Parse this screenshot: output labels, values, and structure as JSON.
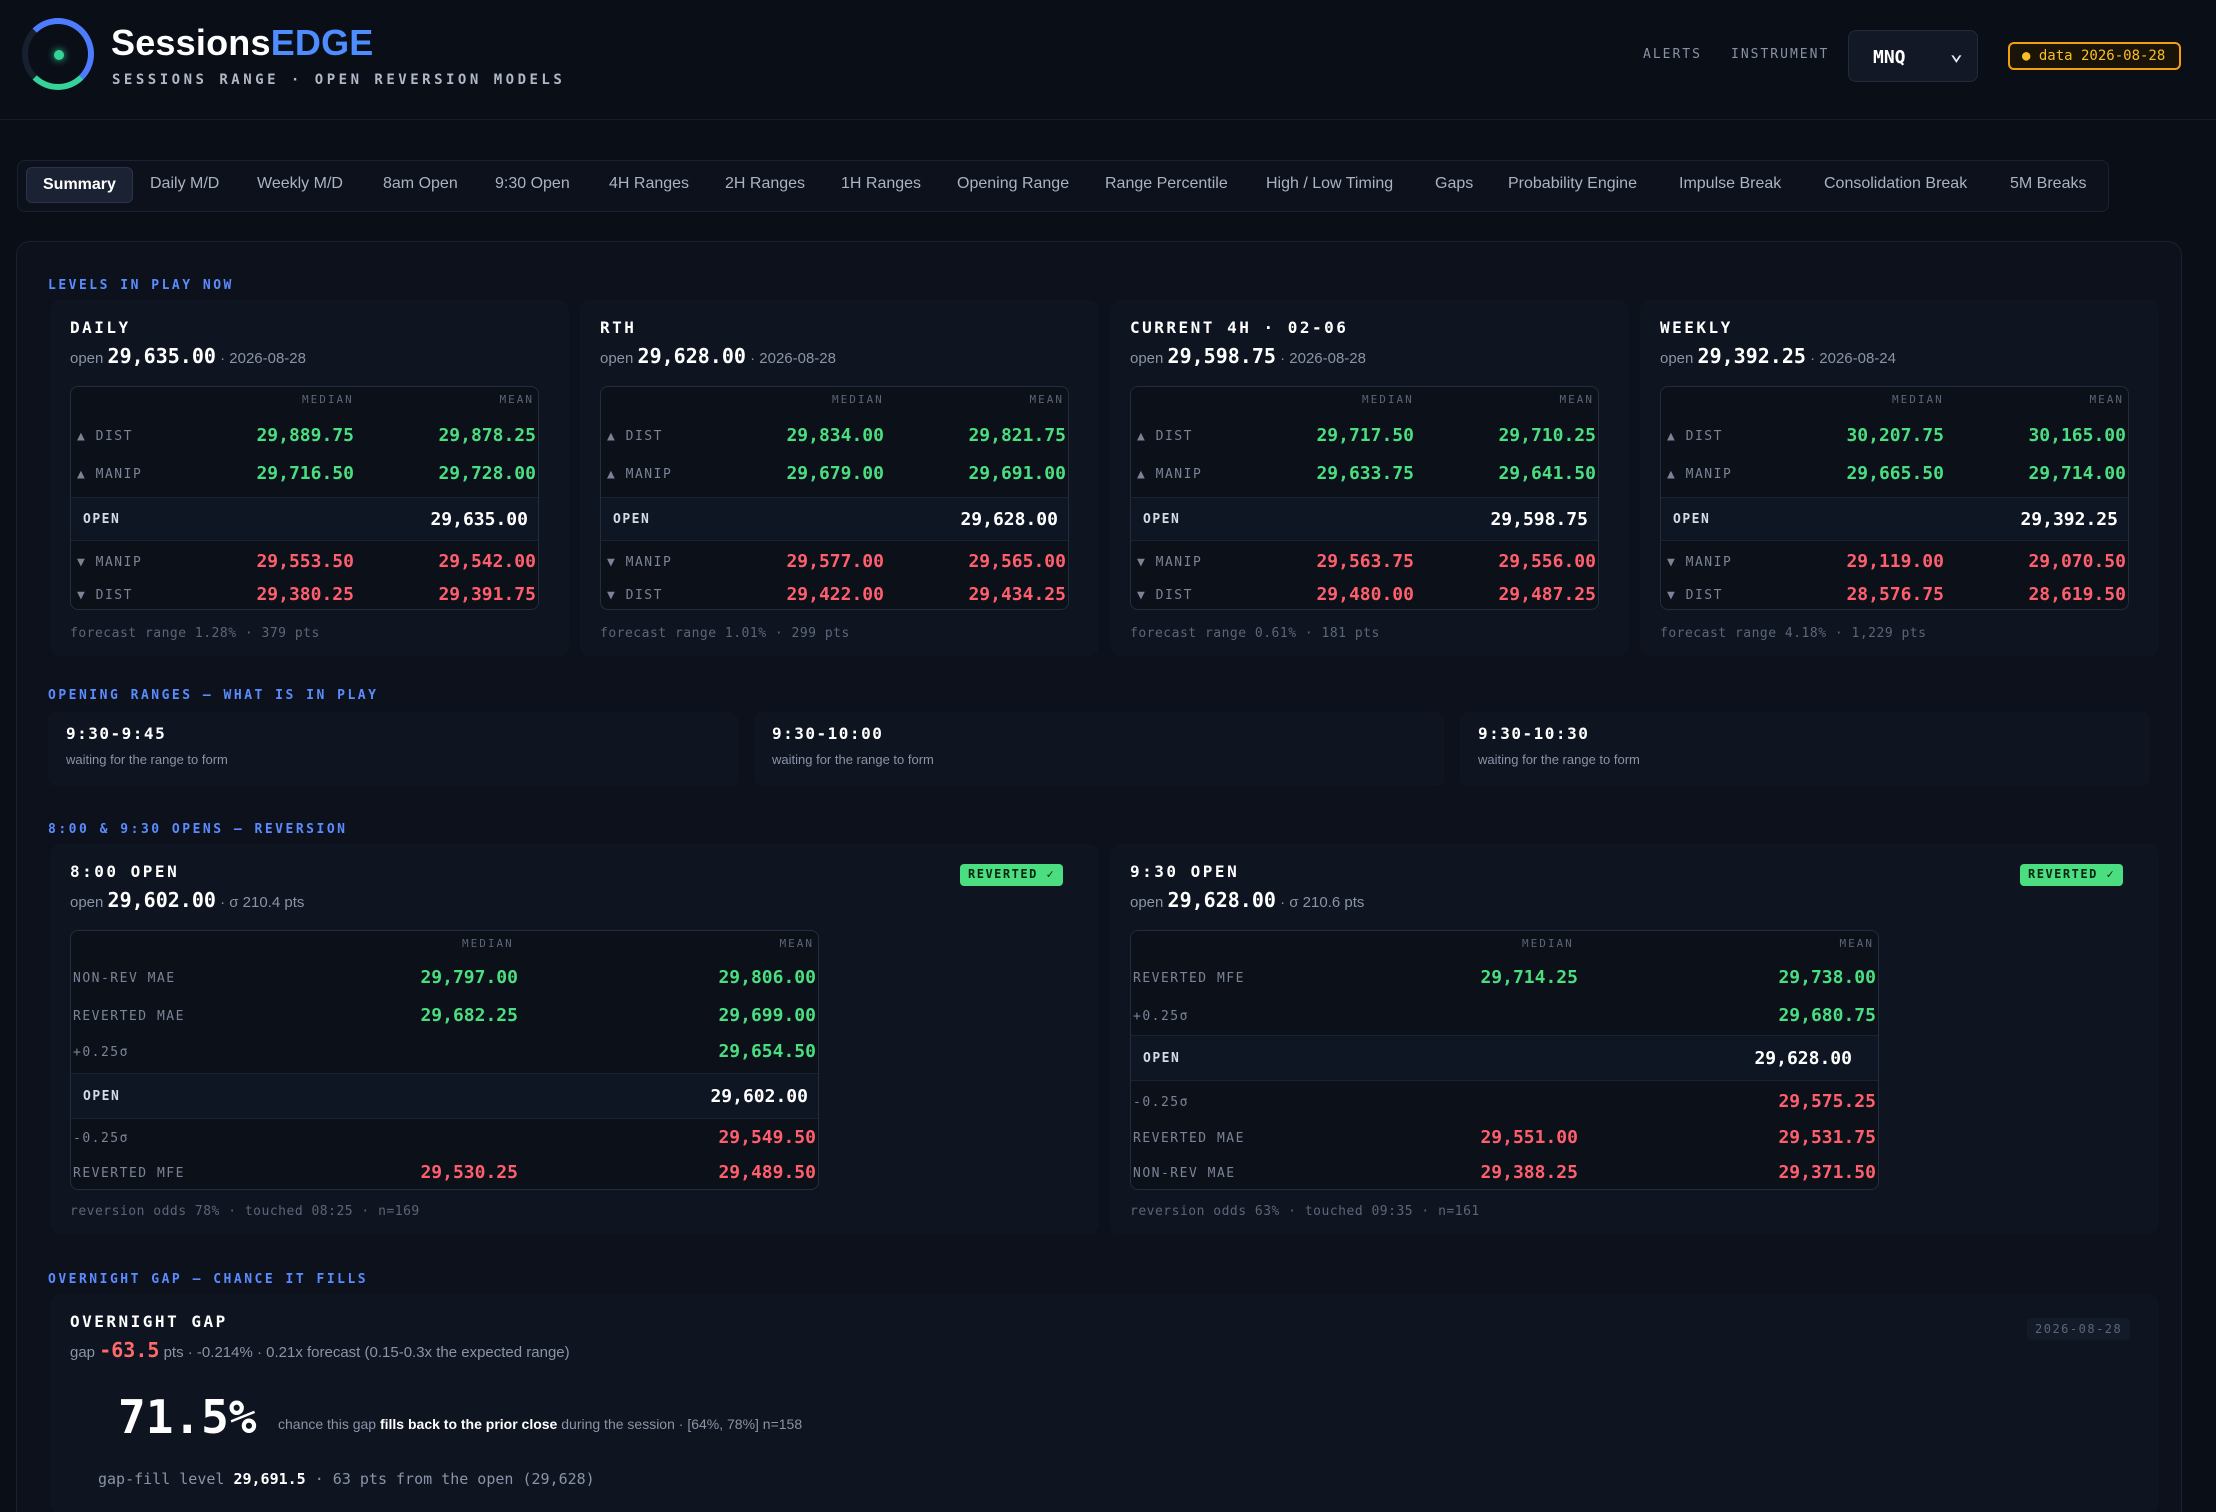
{
  "header": {
    "brand_main": "Sessions",
    "brand_accent": "EDGE",
    "subtitle": "SESSIONS RANGE · OPEN REVERSION MODELS",
    "alerts_label": "ALERTS",
    "instrument_label": "INSTRUMENT",
    "instrument_value": "MNQ",
    "data_badge": "● data 2026-08-28"
  },
  "tabs": [
    {
      "label": "Summary",
      "active": true
    },
    {
      "label": "Daily M/D"
    },
    {
      "label": "Weekly M/D"
    },
    {
      "label": "8am Open"
    },
    {
      "label": "9:30 Open"
    },
    {
      "label": "4H Ranges"
    },
    {
      "label": "2H Ranges"
    },
    {
      "label": "1H Ranges"
    },
    {
      "label": "Opening Range"
    },
    {
      "label": "Range Percentile"
    },
    {
      "label": "High / Low Timing"
    },
    {
      "label": "Gaps"
    },
    {
      "label": "Probability Engine"
    },
    {
      "label": "Impulse Break"
    },
    {
      "label": "Consolidation Break"
    },
    {
      "label": "5M Breaks"
    }
  ],
  "levels": {
    "title": "LEVELS IN PLAY NOW",
    "col_median": "MEDIAN",
    "col_mean": "MEAN",
    "cards": [
      {
        "title": "DAILY",
        "open_prefix": "open",
        "open": "29,635.00",
        "date": "· 2026-08-28",
        "rows": [
          {
            "label": "▲ DIST",
            "median": "29,889.75",
            "mean": "29,878.25",
            "tone": "g"
          },
          {
            "label": "▲ MANIP",
            "median": "29,716.50",
            "mean": "29,728.00",
            "tone": "g"
          },
          {
            "label": "OPEN",
            "median": "",
            "mean": "29,635.00",
            "tone": "w"
          },
          {
            "label": "▼ MANIP",
            "median": "29,553.50",
            "mean": "29,542.00",
            "tone": "r"
          },
          {
            "label": "▼ DIST",
            "median": "29,380.25",
            "mean": "29,391.75",
            "tone": "r"
          }
        ],
        "footer": "forecast range 1.28% · 379 pts"
      },
      {
        "title": "RTH",
        "open_prefix": "open",
        "open": "29,628.00",
        "date": "· 2026-08-28",
        "rows": [
          {
            "label": "▲ DIST",
            "median": "29,834.00",
            "mean": "29,821.75",
            "tone": "g"
          },
          {
            "label": "▲ MANIP",
            "median": "29,679.00",
            "mean": "29,691.00",
            "tone": "g"
          },
          {
            "label": "OPEN",
            "median": "",
            "mean": "29,628.00",
            "tone": "w"
          },
          {
            "label": "▼ MANIP",
            "median": "29,577.00",
            "mean": "29,565.00",
            "tone": "r"
          },
          {
            "label": "▼ DIST",
            "median": "29,422.00",
            "mean": "29,434.25",
            "tone": "r"
          }
        ],
        "footer": "forecast range 1.01% · 299 pts"
      },
      {
        "title": "CURRENT 4H · 02-06",
        "open_prefix": "open",
        "open": "29,598.75",
        "date": "· 2026-08-28",
        "rows": [
          {
            "label": "▲ DIST",
            "median": "29,717.50",
            "mean": "29,710.25",
            "tone": "g"
          },
          {
            "label": "▲ MANIP",
            "median": "29,633.75",
            "mean": "29,641.50",
            "tone": "g"
          },
          {
            "label": "OPEN",
            "median": "",
            "mean": "29,598.75",
            "tone": "w"
          },
          {
            "label": "▼ MANIP",
            "median": "29,563.75",
            "mean": "29,556.00",
            "tone": "r"
          },
          {
            "label": "▼ DIST",
            "median": "29,480.00",
            "mean": "29,487.25",
            "tone": "r"
          }
        ],
        "footer": "forecast range 0.61% · 181 pts"
      },
      {
        "title": "WEEKLY",
        "open_prefix": "open",
        "open": "29,392.25",
        "date": "· 2026-08-24",
        "rows": [
          {
            "label": "▲ DIST",
            "median": "30,207.75",
            "mean": "30,165.00",
            "tone": "g"
          },
          {
            "label": "▲ MANIP",
            "median": "29,665.50",
            "mean": "29,714.00",
            "tone": "g"
          },
          {
            "label": "OPEN",
            "median": "",
            "mean": "29,392.25",
            "tone": "w"
          },
          {
            "label": "▼ MANIP",
            "median": "29,119.00",
            "mean": "29,070.50",
            "tone": "r"
          },
          {
            "label": "▼ DIST",
            "median": "28,576.75",
            "mean": "28,619.50",
            "tone": "r"
          }
        ],
        "footer": "forecast range 4.18% · 1,229 pts"
      }
    ]
  },
  "opening_ranges": {
    "title": "OPENING RANGES — WHAT IS IN PLAY",
    "cards": [
      {
        "title": "9:30-9:45",
        "sub": "waiting for the range to form"
      },
      {
        "title": "9:30-10:00",
        "sub": "waiting for the range to form"
      },
      {
        "title": "9:30-10:30",
        "sub": "waiting for the range to form"
      }
    ]
  },
  "reversion": {
    "title": "8:00 & 9:30 OPENS — REVERSION",
    "col_median": "MEDIAN",
    "col_mean": "MEAN",
    "cards": [
      {
        "title": "8:00 OPEN",
        "badge": "REVERTED ✓",
        "open_prefix": "open",
        "open": "29,602.00",
        "sigma": "· σ 210.4 pts",
        "rows": [
          {
            "label": "NON-REV MAE",
            "median": "29,797.00",
            "mean": "29,806.00",
            "tone": "g"
          },
          {
            "label": "REVERTED MAE",
            "median": "29,682.25",
            "mean": "29,699.00",
            "tone": "g"
          },
          {
            "label": "+0.25σ",
            "median": "",
            "mean": "29,654.50",
            "tone": "g"
          },
          {
            "label": "OPEN",
            "median": "",
            "mean": "29,602.00",
            "tone": "w"
          },
          {
            "label": "-0.25σ",
            "median": "",
            "mean": "29,549.50",
            "tone": "r"
          },
          {
            "label": "REVERTED MFE",
            "median": "29,530.25",
            "mean": "29,489.50",
            "tone": "r"
          }
        ],
        "footer": "reversion odds 78% · touched 08:25 · n=169"
      },
      {
        "title": "9:30 OPEN",
        "badge": "REVERTED ✓",
        "open_prefix": "open",
        "open": "29,628.00",
        "sigma": "· σ 210.6 pts",
        "rows": [
          {
            "label": "REVERTED MFE",
            "median": "29,714.25",
            "mean": "29,738.00",
            "tone": "g"
          },
          {
            "label": "+0.25σ",
            "median": "",
            "mean": "29,680.75",
            "tone": "g"
          },
          {
            "label": "OPEN",
            "median": "",
            "mean": "29,628.00",
            "tone": "w"
          },
          {
            "label": "-0.25σ",
            "median": "",
            "mean": "29,575.25",
            "tone": "r"
          },
          {
            "label": "REVERTED MAE",
            "median": "29,551.00",
            "mean": "29,531.75",
            "tone": "r"
          },
          {
            "label": "NON-REV MAE",
            "median": "29,388.25",
            "mean": "29,371.50",
            "tone": "r"
          }
        ],
        "footer": "reversion odds 63% · touched 09:35 · n=161"
      }
    ]
  },
  "gap": {
    "title": "OVERNIGHT GAP — CHANCE IT FILLS",
    "card_title": "OVERNIGHT GAP",
    "date_chip": "2026-08-28",
    "gap_prefix": "gap",
    "gap_value": "-63.5",
    "gap_rest": "pts · -0.214% · 0.21x forecast (0.15-0.3x the expected range)",
    "probability": "71.5%",
    "desc_a": "chance this gap",
    "desc_b": "fills back to the prior close",
    "desc_c": "during the session · [64%, 78%] n=158",
    "fill_prefix": "gap-fill level",
    "fill_level": "29,691.5",
    "fill_rest": "· 63 pts from the open (29,628)"
  }
}
